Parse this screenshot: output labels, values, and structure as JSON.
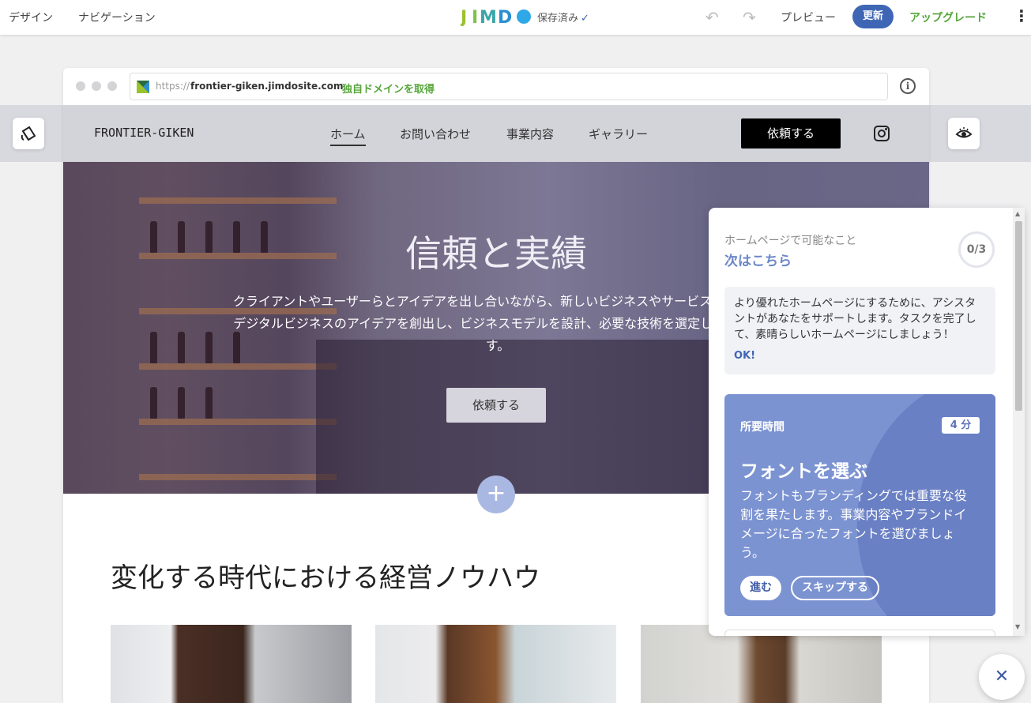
{
  "topbar": {
    "design": "デザイン",
    "navigation": "ナビゲーション",
    "logo": "JIMDO",
    "saved": "保存済み",
    "preview": "プレビュー",
    "update": "更新",
    "upgrade": "アップグレード"
  },
  "browser": {
    "https": "https://",
    "domain": "frontier-giken.jimdosite.com",
    "get_domain": "独自ドメインを取得"
  },
  "site": {
    "name": "FRONTIER-GIKEN",
    "nav": [
      "ホーム",
      "お問い合わせ",
      "事業内容",
      "ギャラリー"
    ],
    "cta": "依頼する"
  },
  "hero": {
    "title": "信頼と実績",
    "line1": "クライアントやユーザーらとアイデアを出し合いながら、新しいビジネスやサービスを生み出",
    "line2": "デジタルビジネスのアイデアを創出し、ビジネスモデルを設計、必要な技術を選定してアイデ",
    "line3": "す。",
    "button": "依頼する"
  },
  "section": {
    "title": "変化する時代における経営ノウハウ"
  },
  "assistant": {
    "subtitle": "ホームページで可能なこと",
    "title": "次はこちら",
    "progress": "0/3",
    "intro": "より優れたホームページにするために、アシスタントがあなたをサポートします。タスクを完了して、素晴らしいホームページにしましょう！",
    "ok": "OK!",
    "task": {
      "time_label": "所要時間",
      "time_value": "4 分",
      "title": "フォントを選ぶ",
      "desc": "フォントもブランディングでは重要な役割を果たします。事業内容やブランドイメージに合ったフォントを選びましょう。",
      "go": "進む",
      "skip": "スキップする"
    }
  },
  "colors": {
    "accent": "#3f66b4",
    "upgrade": "#56a63a",
    "task_card": "#7c93d2"
  },
  "icons": [
    "undo-icon",
    "redo-icon",
    "check-icon",
    "kebab-menu-icon",
    "info-icon",
    "instagram-icon",
    "paint-bucket-icon",
    "eye-icon",
    "plus-icon",
    "close-icon"
  ]
}
